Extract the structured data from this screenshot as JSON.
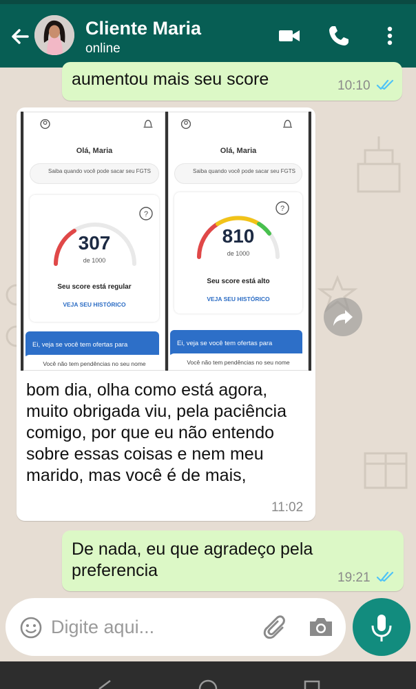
{
  "header": {
    "contact_name": "Cliente Maria",
    "status": "online"
  },
  "messages": {
    "first_out": {
      "text": "aumentou mais seu score",
      "time": "10:10"
    },
    "incoming": {
      "text_lines": [
        "bom dia, olha como está agora,",
        "muito obrigada viu, pela paciência",
        "comigo, por que eu não entendo",
        "sobre essas coisas e nem meu",
        "marido, mas você é de mais,"
      ],
      "time": "11:02"
    },
    "last_out": {
      "text_lines": [
        "De nada, eu que agradeço pela",
        "preferencia"
      ],
      "time": "19:21"
    }
  },
  "screenshot_before": {
    "greeting": "Olá, Maria",
    "fgts": "Saiba quando você pode sacar seu FGTS",
    "score": "307",
    "scale": "de 1000",
    "status": "Seu score está regular",
    "history": "VEJA SEU HISTÓRICO",
    "offers": "Ei, veja se você tem ofertas para",
    "pending": "Você não tem pendências no seu nome"
  },
  "screenshot_after": {
    "greeting": "Olá, Maria",
    "fgts": "Saiba quando você pode sacar seu FGTS",
    "score": "810",
    "scale": "de 1000",
    "status": "Seu score está alto",
    "history": "VEJA SEU HISTÓRICO",
    "offers": "Ei, veja se você tem ofertas para",
    "pending": "Você não tem pendências no seu nome"
  },
  "composer": {
    "placeholder": "Digite aqui..."
  },
  "icons": {
    "back": "arrow-left-icon",
    "video": "video-camera-icon",
    "call": "phone-icon",
    "menu": "more-vertical-icon",
    "emoji": "emoji-icon",
    "attach": "paperclip-icon",
    "camera": "camera-icon",
    "mic": "microphone-icon",
    "forward": "forward-icon"
  },
  "colors": {
    "header": "#075e54",
    "outgoing": "#dcf8c6",
    "incoming": "#ffffff",
    "ticks": "#4fc3f7",
    "mic": "#128c7e"
  }
}
